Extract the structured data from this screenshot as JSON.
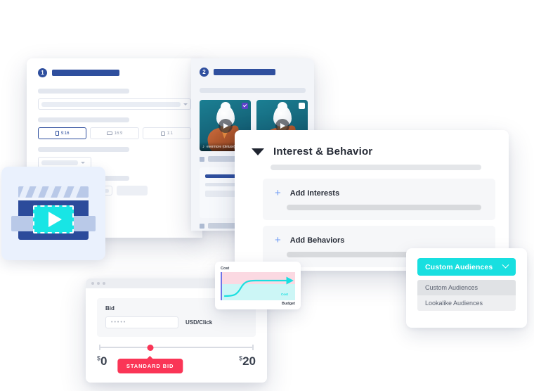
{
  "panel_one": {
    "step_number": "1",
    "ratio_tabs": [
      {
        "label": "9:16",
        "shape": "portrait",
        "active": true
      },
      {
        "label": "16:9",
        "shape": "landscape",
        "active": false
      },
      {
        "label": "1:1",
        "shape": "square",
        "active": false
      }
    ]
  },
  "panel_two": {
    "step_number": "2",
    "thumbnails": [
      {
        "audio_label": "evermore (deluxe)",
        "selected": true,
        "play_icon": "play-icon"
      },
      {
        "audio_label": "",
        "selected": false,
        "play_icon": "play-icon"
      }
    ]
  },
  "interest_panel": {
    "title": "Interest & Behavior",
    "collapse_icon": "triangle-down-icon",
    "blocks": [
      {
        "title": "Add Interests",
        "icon": "plus-icon"
      },
      {
        "title": "Add Behaviors",
        "icon": "plus-icon"
      }
    ]
  },
  "audiences_panel": {
    "button_label": "Custom Audiences",
    "button_icon": "chevron-down-icon",
    "button_color": "#18dfe0",
    "options": [
      {
        "label": "Custom Audiences",
        "highlighted": true
      },
      {
        "label": "Lookalike Audiences",
        "highlighted": false
      }
    ]
  },
  "bid_panel": {
    "field_label": "Bid",
    "field_value": "•••••",
    "unit_label": "USD/Click",
    "slider": {
      "min_currency": "$",
      "min_value": "0",
      "max_currency": "$",
      "max_value": "20",
      "handle_label": "STANDARD BID",
      "handle_position_percent": 33,
      "accent_color": "#fa3556"
    }
  },
  "chart_data": {
    "type": "line",
    "title": "",
    "ylabel": "Cost",
    "xlabel": "Budget",
    "series": [
      {
        "name": "Cost",
        "x": [
          0,
          10,
          20,
          30,
          45,
          60,
          100
        ],
        "y": [
          8,
          9,
          14,
          42,
          58,
          60,
          60
        ]
      }
    ],
    "xlim": [
      0,
      100
    ],
    "ylim": [
      0,
      100
    ],
    "grid": false,
    "legend_position": "inline-right",
    "bands": [
      {
        "label": "upper",
        "color": "#fbd9e2",
        "from": 58,
        "to": 100
      },
      {
        "label": "lower",
        "color": "#ccf6f6",
        "from": 0,
        "to": 58
      }
    ],
    "series_color": "#18dfe0",
    "axis_color": "#6f74e8"
  },
  "clapper_card": {
    "icon": "clapperboard-video-icon",
    "play_icon": "play-icon",
    "accent_color": "#18e5e5"
  }
}
